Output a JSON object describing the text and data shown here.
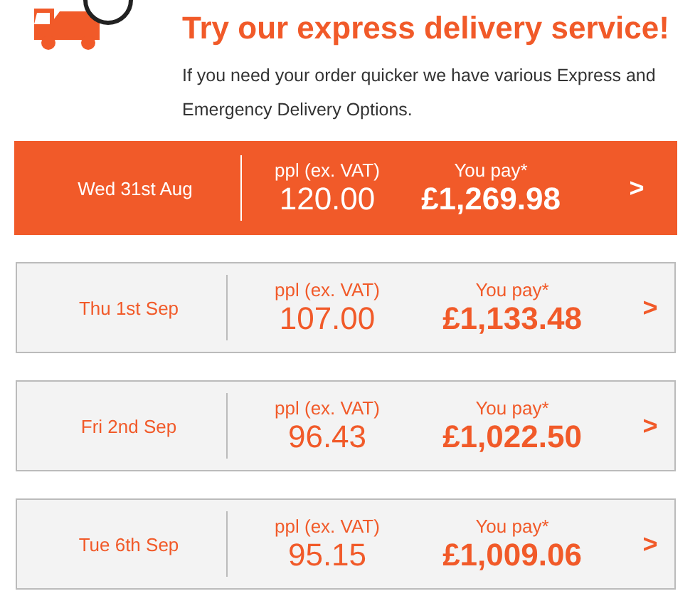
{
  "header": {
    "title_lines": [
      "Try our express delivery service!"
    ],
    "description": "If you need your order quicker we have various Express and Emergency Delivery Options."
  },
  "options": [
    {
      "date": "Wed 31st Aug",
      "ppl_label": "ppl (ex. VAT)",
      "ppl": "120.00",
      "pay_label": "You pay*",
      "pay": "£1,269.98",
      "arrow": ">",
      "selected": true
    },
    {
      "date": "Thu 1st Sep",
      "ppl_label": "ppl (ex. VAT)",
      "ppl": "107.00",
      "pay_label": "You pay*",
      "pay": "£1,133.48",
      "arrow": ">",
      "selected": false
    },
    {
      "date": "Fri 2nd Sep",
      "ppl_label": "ppl (ex. VAT)",
      "ppl": "96.43",
      "pay_label": "You pay*",
      "pay": "£1,022.50",
      "arrow": ">",
      "selected": false
    },
    {
      "date": "Tue 6th Sep",
      "ppl_label": "ppl (ex. VAT)",
      "ppl": "95.15",
      "pay_label": "You pay*",
      "pay": "£1,009.06",
      "arrow": ">",
      "selected": false
    }
  ]
}
